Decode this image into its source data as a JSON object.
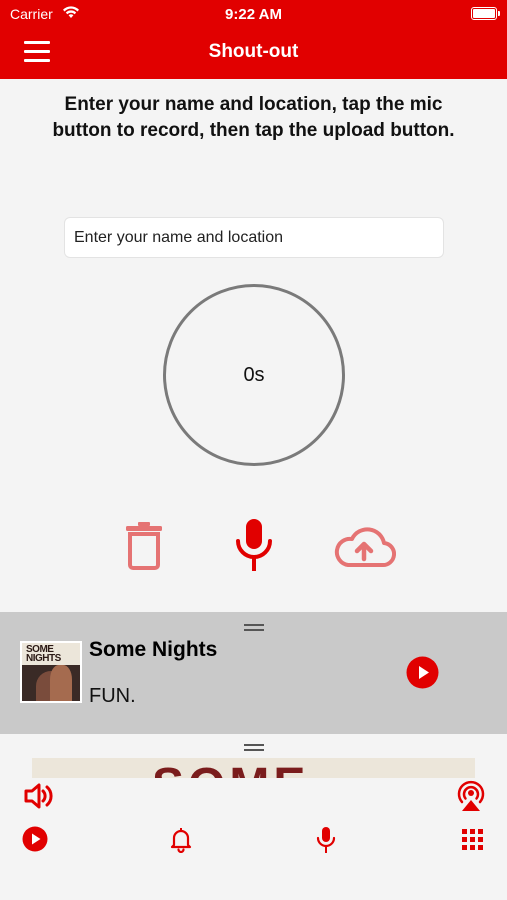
{
  "status_bar": {
    "carrier": "Carrier",
    "time": "9:22 AM"
  },
  "nav": {
    "title": "Shout-out",
    "menu_icon": "hamburger-menu-icon"
  },
  "instructions": "Enter your name and location, tap the mic button to record, then tap the upload button.",
  "name_field": {
    "placeholder": "Enter your name and location",
    "value": ""
  },
  "recorder": {
    "elapsed": "0s"
  },
  "actions": {
    "delete_icon": "trash-icon",
    "record_icon": "microphone-icon",
    "upload_icon": "cloud-upload-icon"
  },
  "now_playing": {
    "title": "Some Nights",
    "artist": "FUN.",
    "album_art_text": "SOME NIGHTS"
  },
  "expanded_art": {
    "text": "SOME"
  },
  "bottom_bar": {
    "volume_icon": "speaker-volume-icon",
    "airplay_icon": "airplay-icon",
    "play_icon": "play-circle-icon",
    "notifications_icon": "bell-icon",
    "shoutout_icon": "microphone-icon",
    "grid_icon": "grid-icon"
  },
  "colors": {
    "brand_red": "#e10000",
    "muted_red": "#e57373",
    "panel_gray": "#c9c9c9"
  }
}
